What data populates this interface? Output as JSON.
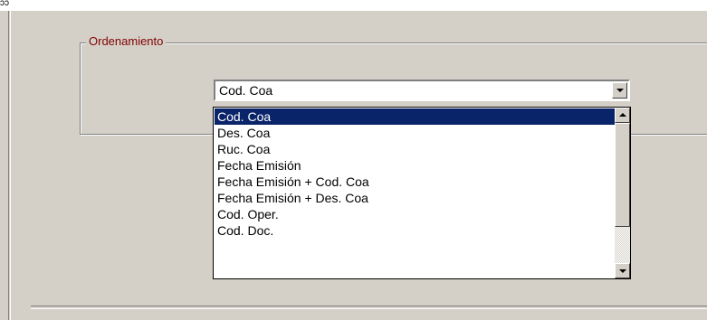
{
  "top_fragment": "ɔɔ",
  "group": {
    "label": "Ordenamiento"
  },
  "combo": {
    "value": "Cod. Coa"
  },
  "dropdown": {
    "items": [
      "Cod. Coa",
      "Des. Coa",
      "Ruc. Coa",
      "Fecha Emisión",
      "Fecha Emisión + Cod. Coa",
      "Fecha Emisión + Des. Coa",
      "Cod. Oper.",
      "Cod. Doc."
    ],
    "selected": "Cod. Coa"
  },
  "colors": {
    "panel_bg": "#d4d0c8",
    "group_label": "#800000",
    "selection_bg": "#0a246a"
  }
}
